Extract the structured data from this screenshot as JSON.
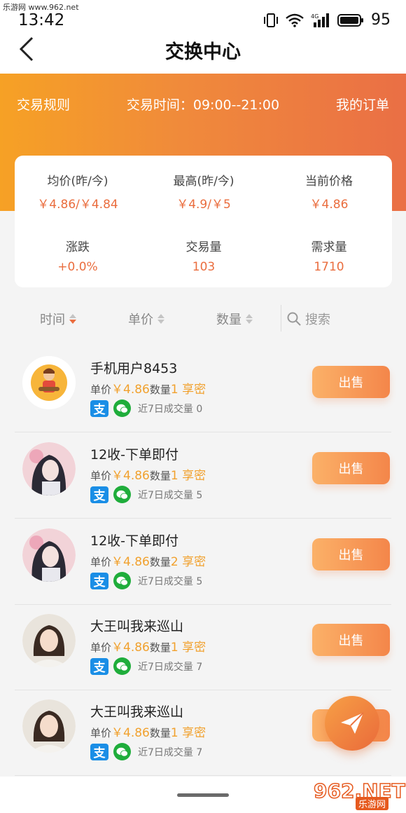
{
  "watermark_top": "乐游网 www.962.net",
  "status": {
    "time": "13:42",
    "network": "4G",
    "battery": "95"
  },
  "nav": {
    "title": "交换中心"
  },
  "banner": {
    "rules": "交易规则",
    "trade_time": "交易时间：09:00--21:00",
    "my_orders": "我的订单"
  },
  "stats": {
    "avg_label": "均价(昨/今)",
    "avg_value": "￥4.86/￥4.84",
    "high_label": "最高(昨/今)",
    "high_value": "￥4.9/￥5",
    "current_label": "当前价格",
    "current_value": "￥4.86",
    "change_label": "涨跌",
    "change_value": "+0.0%",
    "volume_label": "交易量",
    "volume_value": "103",
    "demand_label": "需求量",
    "demand_value": "1710"
  },
  "sortbar": {
    "time": "时间",
    "price": "单价",
    "qty": "数量",
    "search": "搜索"
  },
  "items": [
    {
      "name": "手机用户8453",
      "price_label": "单价",
      "price": "￥4.86",
      "qty_label": "数量",
      "qty": "1 享密",
      "vol_label": "近7日成交量",
      "vol": "0",
      "btn": "出售"
    },
    {
      "name": "12收-下单即付",
      "price_label": "单价",
      "price": "￥4.86",
      "qty_label": "数量",
      "qty": "1 享密",
      "vol_label": "近7日成交量",
      "vol": "5",
      "btn": "出售"
    },
    {
      "name": "12收-下单即付",
      "price_label": "单价",
      "price": "￥4.86",
      "qty_label": "数量",
      "qty": "2 享密",
      "vol_label": "近7日成交量",
      "vol": "5",
      "btn": "出售"
    },
    {
      "name": "大王叫我来巡山",
      "price_label": "单价",
      "price": "￥4.86",
      "qty_label": "数量",
      "qty": "1 享密",
      "vol_label": "近7日成交量",
      "vol": "7",
      "btn": "出售"
    },
    {
      "name": "大王叫我来巡山",
      "price_label": "单价",
      "price": "￥4.86",
      "qty_label": "数量",
      "qty": "1 享密",
      "vol_label": "近7日成交量",
      "vol": "7",
      "btn": "出售"
    }
  ],
  "watermark_bottom": {
    "big": "962.NET",
    "small": "乐游网"
  },
  "colors": {
    "accent": "#ea6d3e",
    "gold": "#f1a12e",
    "alipay": "#1a8ee6",
    "wechat": "#1fad3b"
  }
}
